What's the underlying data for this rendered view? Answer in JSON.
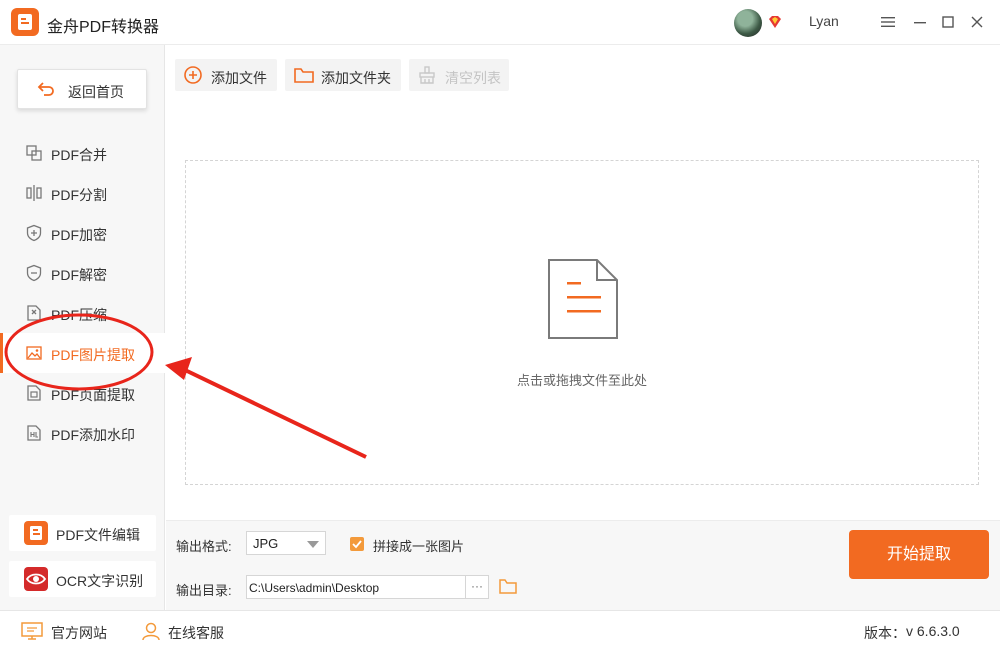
{
  "app": {
    "title": "金舟PDF转换器",
    "username": "Lyan",
    "accent": "#f26a21"
  },
  "icons": {
    "logo": "app-logo-icon",
    "vip": "vip-diamond-icon",
    "minimize": "minimize-icon",
    "maximize": "maximize-icon",
    "close": "close-icon"
  },
  "sidebar": {
    "home_label": "返回首页",
    "items": [
      {
        "label": "PDF合并",
        "icon": "merge-icon"
      },
      {
        "label": "PDF分割",
        "icon": "split-icon"
      },
      {
        "label": "PDF加密",
        "icon": "shield-lock-icon"
      },
      {
        "label": "PDF解密",
        "icon": "shield-unlock-icon"
      },
      {
        "label": "PDF压缩",
        "icon": "compress-icon"
      },
      {
        "label": "PDF图片提取",
        "icon": "image-icon",
        "active": true
      },
      {
        "label": "PDF页面提取",
        "icon": "page-icon"
      },
      {
        "label": "PDF添加水印",
        "icon": "watermark-icon"
      }
    ],
    "bottom": [
      {
        "label": "PDF文件编辑",
        "icon": "pdf-edit-icon",
        "color": "#f26a21"
      },
      {
        "label": "OCR文字识别",
        "icon": "ocr-eye-icon",
        "color": "#d42a2a"
      }
    ]
  },
  "toolbar": {
    "add_file": "添加文件",
    "add_folder": "添加文件夹",
    "clear_list": "清空列表"
  },
  "dropzone": {
    "hint": "点击或拖拽文件至此处"
  },
  "output": {
    "format_label": "输出格式:",
    "format_value": "JPG",
    "merge_checkbox_label": "拼接成一张图片",
    "merge_checked": true,
    "dir_label": "输出目录:",
    "dir_value": "C:\\Users\\admin\\Desktop",
    "browse_label": "···",
    "start_label": "开始提取"
  },
  "statusbar": {
    "website": "官方网站",
    "support": "在线客服",
    "version_label": "版本：",
    "version_value": "v 6.6.3.0"
  }
}
